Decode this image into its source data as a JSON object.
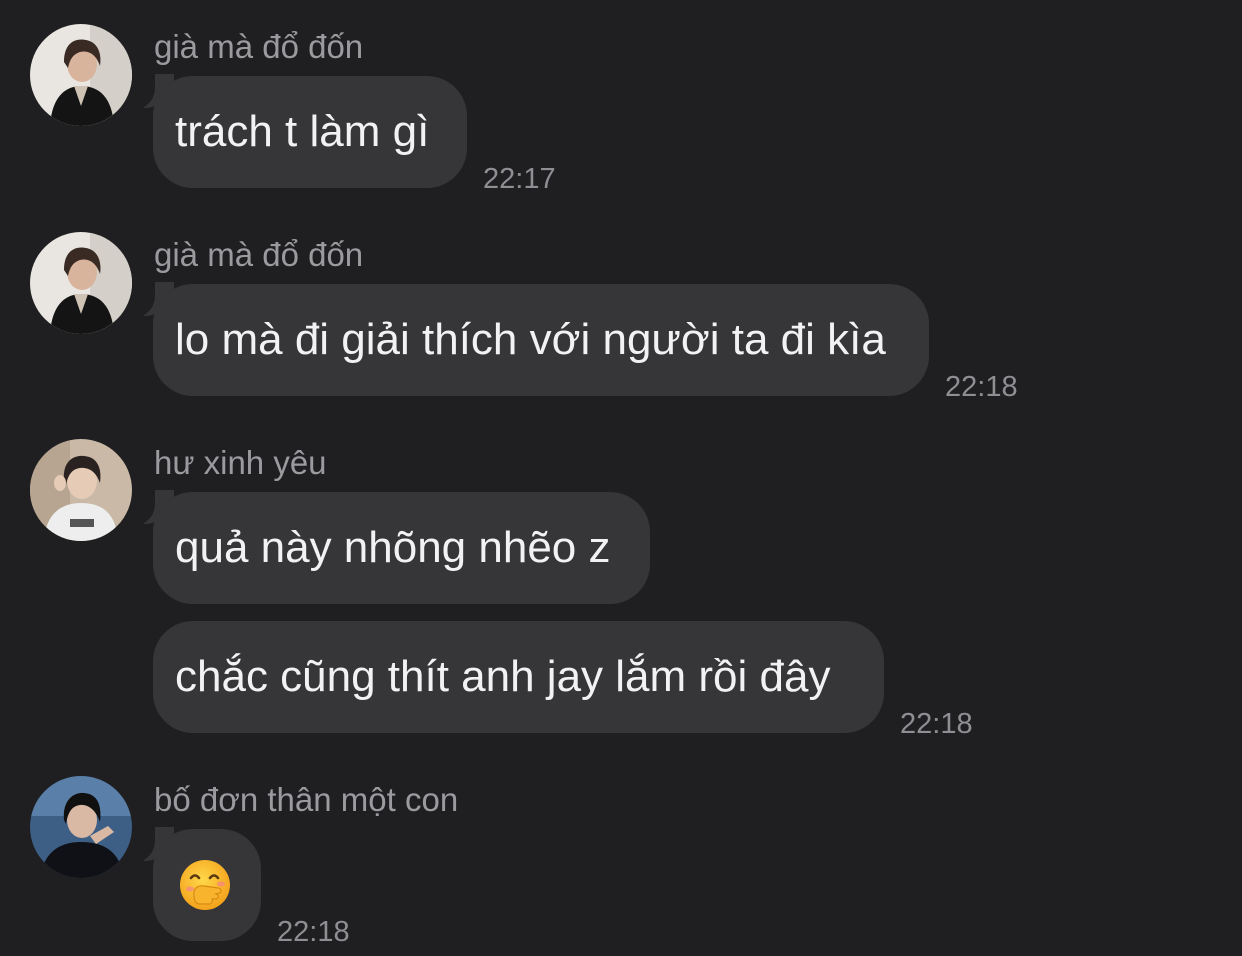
{
  "messages": [
    {
      "sender": "già mà đổ đốn",
      "text": "trách t làm gì",
      "time": "22:17"
    },
    {
      "sender": "già mà đổ đốn",
      "text": "lo mà đi giải thích với người ta đi kìa",
      "time": "22:18"
    },
    {
      "sender": "hư xinh yêu",
      "text": "quả này nhõng nhẽo z"
    },
    {
      "text": "chắc cũng thít anh jay lắm rồi đây",
      "time": "22:18"
    },
    {
      "sender": "bố đơn thân một con",
      "emoji": "face-with-hand-over-mouth-icon",
      "time": "22:18"
    }
  ],
  "colors": {
    "background": "#1f1f21",
    "bubble": "#363638",
    "message_text": "#f2f2f4",
    "sender_text": "#9a9a9f",
    "time_text": "#8e8e93"
  }
}
